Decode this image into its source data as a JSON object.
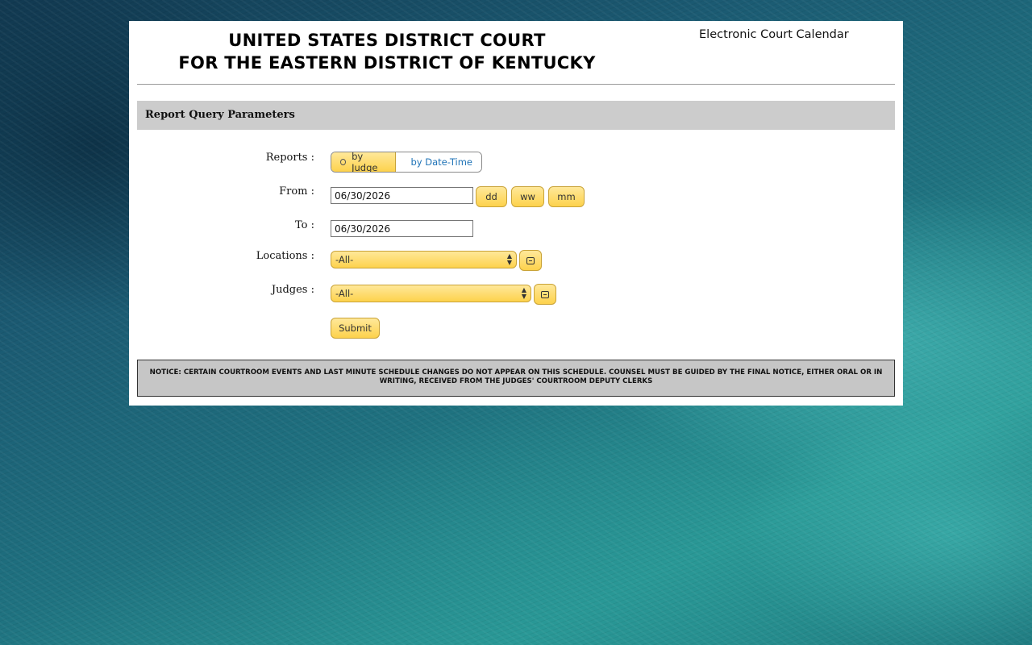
{
  "header": {
    "court_line1": "UNITED STATES DISTRICT COURT",
    "court_line2": "FOR THE EASTERN DISTRICT OF KENTUCKY",
    "app_name": "Electronic Court Calendar"
  },
  "section": {
    "title": "Report Query Parameters"
  },
  "form": {
    "reports_label": "Reports :",
    "reports_options": [
      {
        "label": "by Judge",
        "selected": true
      },
      {
        "label": "by Date-Time",
        "selected": false
      }
    ],
    "from_label": "From :",
    "from_value": "06/30/2026",
    "range_buttons": [
      "dd",
      "ww",
      "mm"
    ],
    "to_label": "To :",
    "to_value": "06/30/2026",
    "locations_label": "Locations :",
    "locations_selected": "-All-",
    "judges_label": "Judges :",
    "judges_selected": "-All-",
    "submit_label": "Submit"
  },
  "notice": {
    "text": "NOTICE: CERTAIN COURTROOM EVENTS AND LAST MINUTE SCHEDULE CHANGES DO NOT APPEAR ON THIS SCHEDULE. COUNSEL MUST BE GUIDED BY THE FINAL NOTICE, EITHER ORAL OR IN WRITING, RECEIVED FROM THE JUDGES' COURTROOM DEPUTY CLERKS"
  },
  "colors": {
    "accent_yellow": "#fdd24c",
    "section_bar": "#cccccc",
    "notice_bg": "#c6c6c6",
    "link_blue": "#1f73b7"
  },
  "icons": {
    "locations_picker": "scroll-icon",
    "judges_picker": "scroll-icon"
  }
}
